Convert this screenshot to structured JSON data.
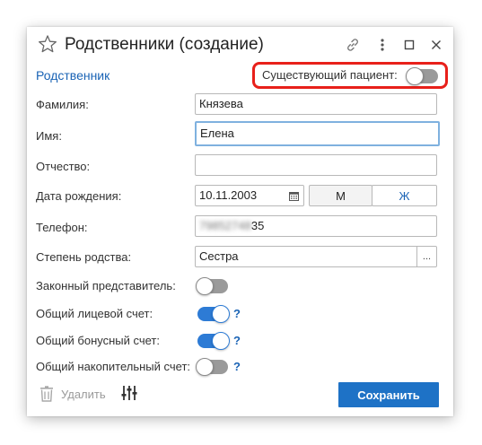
{
  "window": {
    "title": "Родственники (создание)"
  },
  "section": {
    "title": "Родственник",
    "existing_patient_label": "Существующий пациент:",
    "existing_patient_on": false
  },
  "fields": {
    "last_name": {
      "label": "Фамилия:",
      "value": "Князева"
    },
    "first_name": {
      "label": "Имя:",
      "value": "Елена"
    },
    "patronymic": {
      "label": "Отчество:",
      "value": ""
    },
    "birth_date": {
      "label": "Дата рождения:",
      "value": "10.11.2003",
      "gender_male": "М",
      "gender_female": "Ж"
    },
    "phone": {
      "label": "Телефон:",
      "value_hidden": "79852748",
      "value_visible": "35"
    },
    "relation": {
      "label": "Степень родства:",
      "value": "Сестра",
      "ellipsis": "..."
    },
    "legal_rep": {
      "label": "Законный представитель:",
      "on": false
    },
    "shared_personal": {
      "label": "Общий лицевой счет:",
      "on": true,
      "help": "?"
    },
    "shared_bonus": {
      "label": "Общий бонусный счет:",
      "on": true,
      "help": "?"
    },
    "shared_savings": {
      "label": "Общий накопительный счет:",
      "on": false,
      "help": "?"
    }
  },
  "footer": {
    "delete_label": "Удалить",
    "save_label": "Сохранить"
  },
  "colors": {
    "accent": "#1e72c6",
    "link": "#1a63b5",
    "highlight": "#e8201a",
    "toggle_on": "#2d7bd5",
    "toggle_off": "#9a9a9a"
  }
}
